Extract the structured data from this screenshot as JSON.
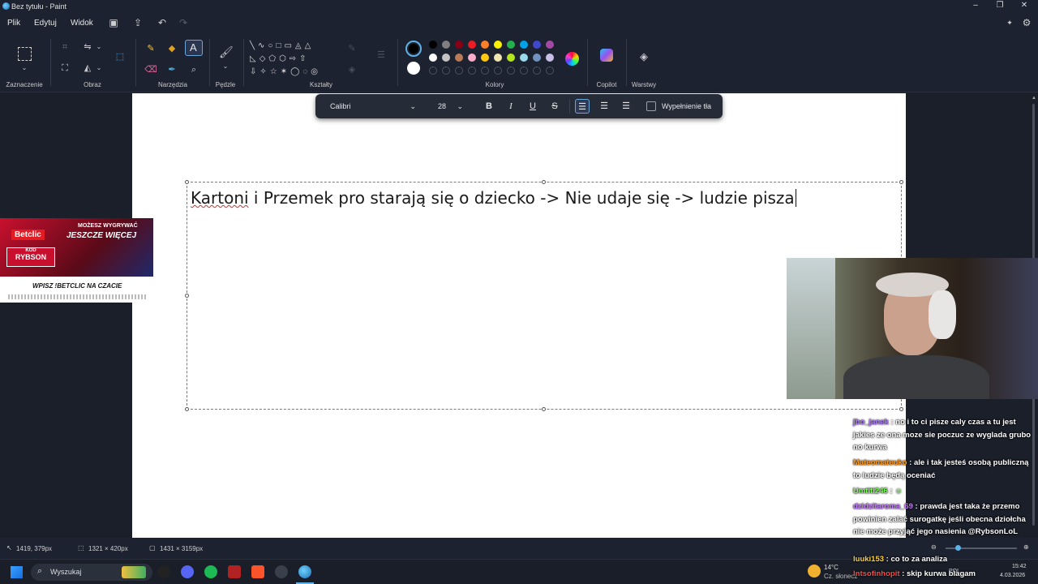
{
  "window": {
    "title": "Bez tytułu - Paint"
  },
  "menu": {
    "file": "Plik",
    "edit": "Edytuj",
    "view": "Widok"
  },
  "ribbon": {
    "groups": {
      "selection": "Zaznaczenie",
      "image": "Obraz",
      "tools": "Narzędzia",
      "brushes": "Pędzle",
      "shapes": "Kształty",
      "colors": "Kolory",
      "copilot": "Copilot",
      "layers": "Warstwy"
    },
    "palette_row1": [
      "#000000",
      "#7f7f7f",
      "#880015",
      "#ed1c24",
      "#ff7f27",
      "#fff200",
      "#22b14c",
      "#00a2e8",
      "#3f48cc",
      "#a349a4"
    ],
    "palette_row2": [
      "#ffffff",
      "#c3c3c3",
      "#b97a57",
      "#ffaec9",
      "#ffc90e",
      "#efe4b0",
      "#b5e61d",
      "#99d9ea",
      "#7092be",
      "#c8bfe7"
    ]
  },
  "text_toolbar": {
    "font": "Calibri",
    "size": "28",
    "bold": "B",
    "italic": "I",
    "underline": "U",
    "strike": "S",
    "fill_label": "Wypełnienie tła"
  },
  "canvas": {
    "text_underlined": "Kartoni",
    "text_rest": " i Przemek pro starają się o dziecko -> Nie udaje się -> ludzie pisza"
  },
  "status": {
    "cursor": "1419, 379px",
    "selection": "1321 × 420px",
    "canvas_size": "1431 × 3159px",
    "zoom_hint": "100%"
  },
  "taskbar": {
    "search": "Wyszukaj",
    "weather_temp": "14°C",
    "weather_desc": "Cz. słonecz",
    "time": "15:42",
    "date": "4.03.2026",
    "lang": "POL"
  },
  "ad": {
    "line1": "MOŻESZ WYGRYWAĆ",
    "line2": "JESZCZE WIĘCEJ",
    "brand": "Betclic",
    "code_label": "KOD",
    "code": "RYBSON",
    "promo": "WPISZ !BETCLIC NA CZACIE"
  },
  "chat": [
    {
      "user": "jbo_janek",
      "color": "#b07cff",
      "text": "no i to ci pisze caly czas a tu jest jakies",
      "text2": "ze ona moze sie poczuc ze wyglada grubo no kurwa"
    },
    {
      "user": "Mateomateuko",
      "color": "#ff9a1f",
      "text": "ale i tak jesteś osobą publiczną to ludzie będą oceniać"
    },
    {
      "user": "Umtiti246",
      "color": "#7cff5a",
      "text": ""
    },
    {
      "user": "dzidzitaroma_69",
      "color": "#c67cff",
      "text": "prawda jest taka że przemo powinien zalać surogatkę jeśli obecna dziołcha nie może przyjąć jego nasienia @RybsonLoL"
    },
    {
      "user": "luuki153",
      "color": "#ffd23a",
      "text": "co to za analiza"
    },
    {
      "user": "Intsofinhopit",
      "color": "#ff4a4a",
      "text": "skip kurwa blagam"
    }
  ]
}
